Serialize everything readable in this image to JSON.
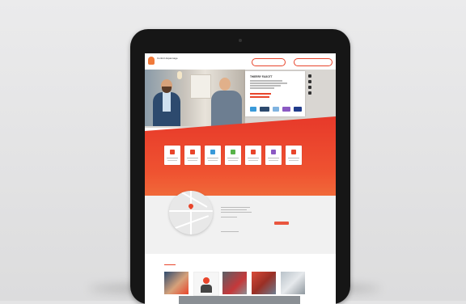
{
  "header": {
    "brand_line1": "Confort dépannage",
    "brand_line2": "",
    "button_1": "",
    "button_2": ""
  },
  "hero": {
    "name": "THIERRY FAGOTT",
    "social_icons": [
      "facebook-icon",
      "linkedin-icon",
      "instagram-icon",
      "twitter-icon"
    ]
  },
  "competences": {
    "title": "",
    "items": [
      {
        "icon": "heater-icon",
        "color": "#e8452b"
      },
      {
        "icon": "boiler-icon",
        "color": "#e8452b"
      },
      {
        "icon": "radiator-icon",
        "color": "#3a9ad9"
      },
      {
        "icon": "leaf-icon",
        "color": "#59b34a"
      },
      {
        "icon": "fan-icon",
        "color": "#e8452b"
      },
      {
        "icon": "thermostat-icon",
        "color": "#8b59c3"
      },
      {
        "icon": "tool-icon",
        "color": "#e8452b"
      }
    ]
  },
  "address": {
    "title": ""
  },
  "gallery": {
    "title": ""
  },
  "banner": {
    "text": ""
  },
  "colors": {
    "accent": "#e8452b",
    "band": "#ef5331",
    "device": "#161616"
  }
}
